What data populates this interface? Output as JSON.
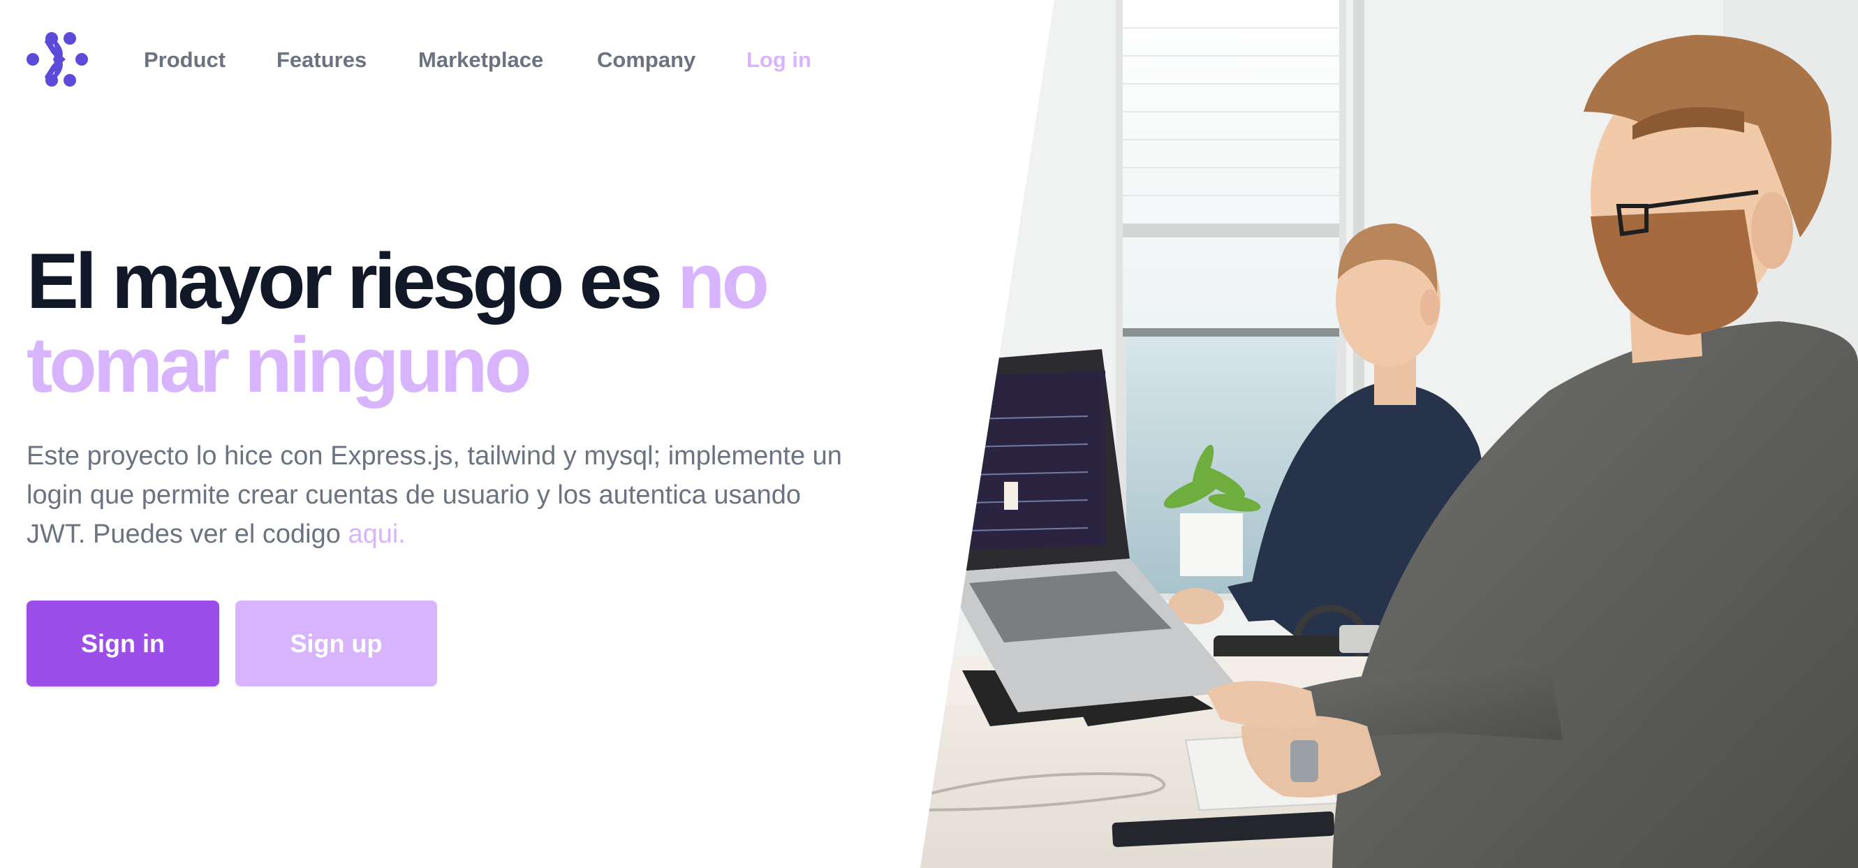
{
  "brand": {
    "logo_icon": "sparkle-logo-icon",
    "color": "#5b4bd8"
  },
  "nav": {
    "items": [
      {
        "label": "Product"
      },
      {
        "label": "Features"
      },
      {
        "label": "Marketplace"
      },
      {
        "label": "Company"
      }
    ],
    "login_label": "Log in"
  },
  "hero": {
    "headline_part1": "El mayor riesgo es ",
    "headline_accent": "no tomar ninguno",
    "description": "Este proyecto lo hice con Express.js, tailwind y mysql; implemente un login que permite crear cuentas de usuario y los autentica usando JWT. Puedes ver el codigo ",
    "description_link": "aqui.",
    "signin_label": "Sign in",
    "signup_label": "Sign up",
    "image": "office-coworkers-at-laptops-photo"
  },
  "colors": {
    "accent": "#d8b4fe",
    "primary_button": "#9b4ee8",
    "heading": "#111827",
    "body_text": "#6b7280"
  }
}
